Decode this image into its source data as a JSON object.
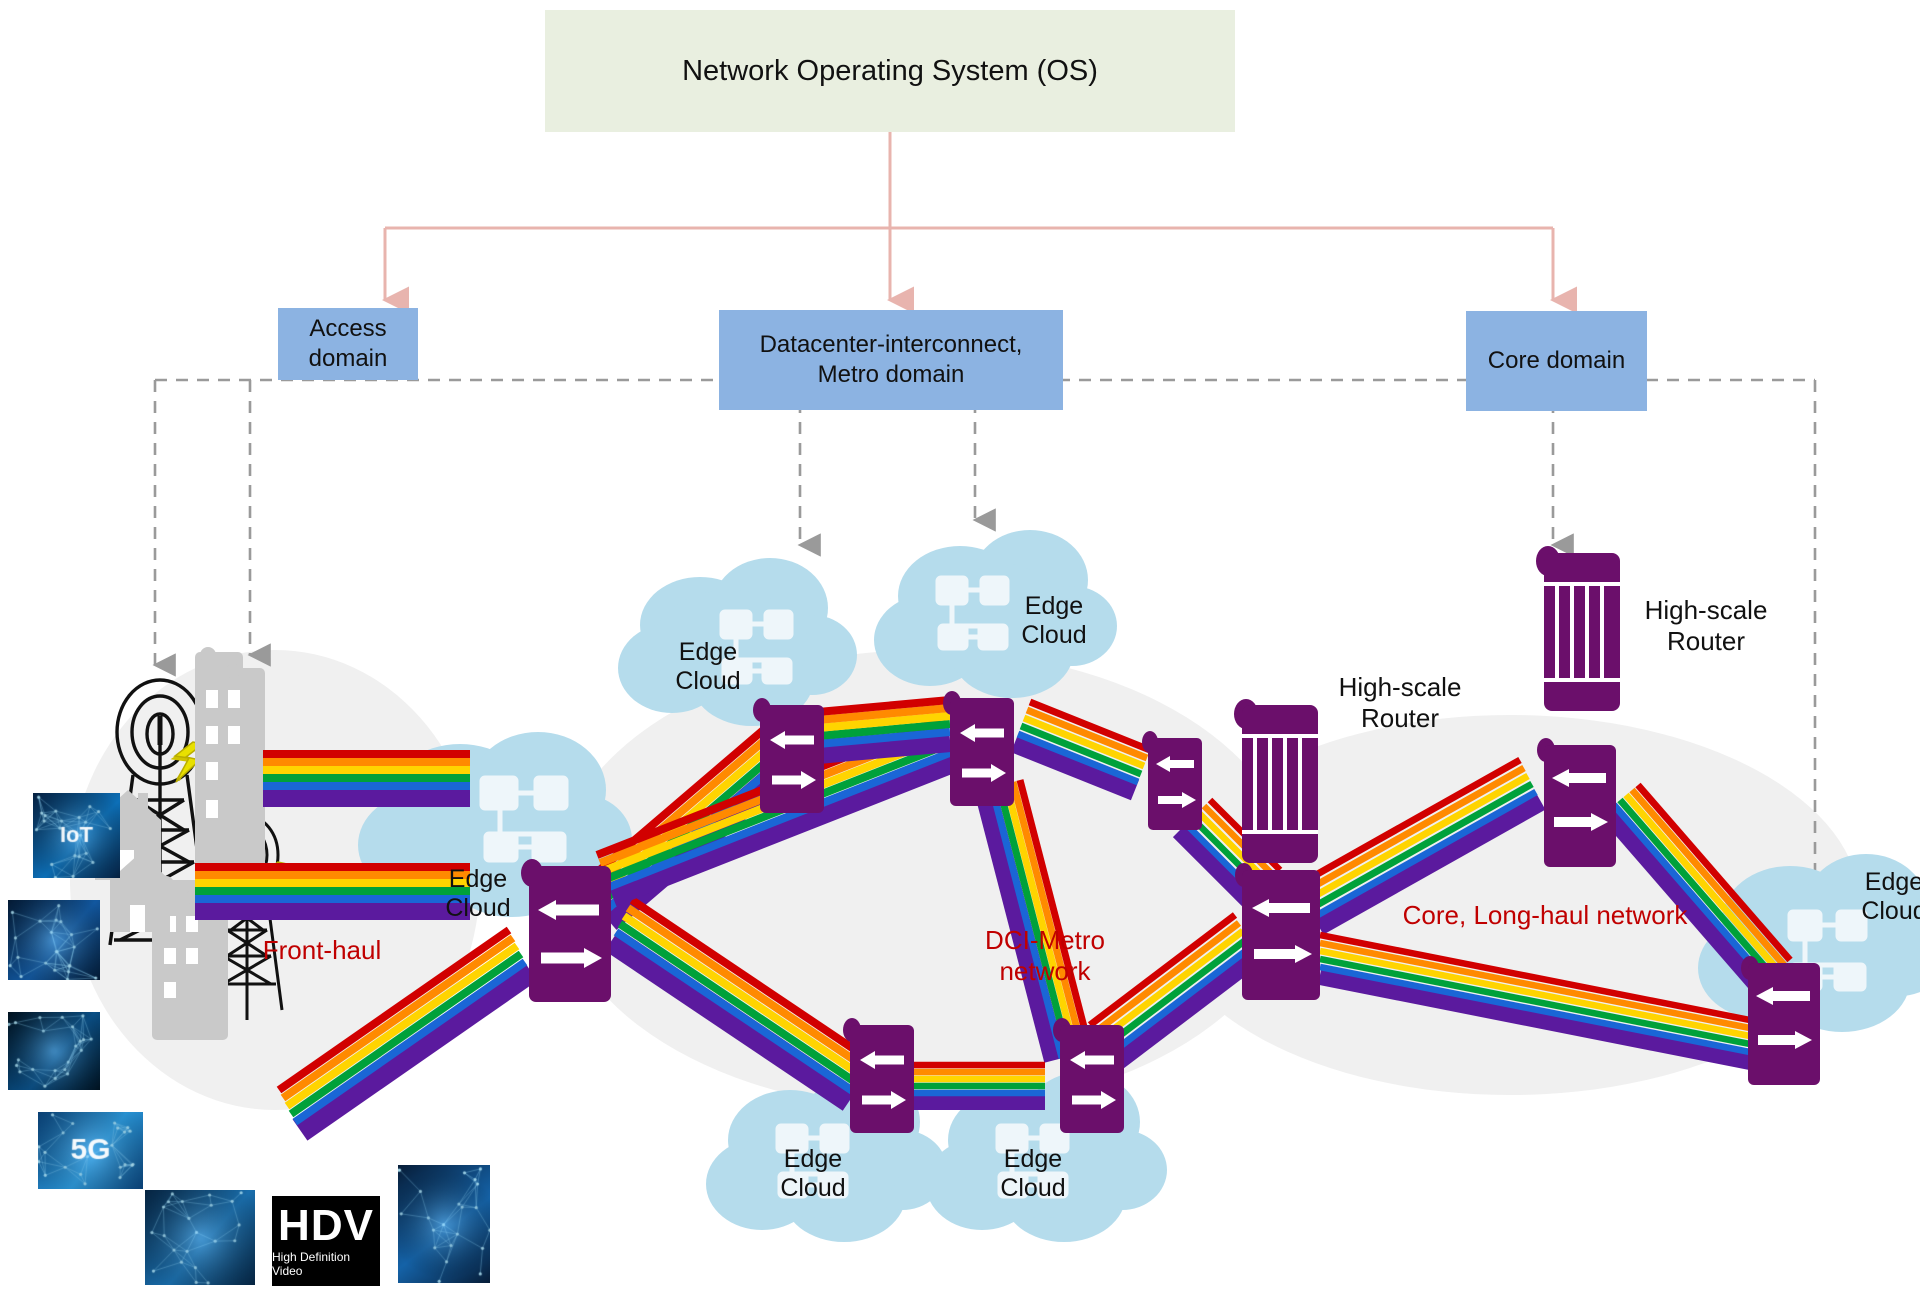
{
  "diagram": {
    "title": "Network Operating System (OS)",
    "domains": [
      {
        "id": "access",
        "label": "Access domain"
      },
      {
        "id": "dci",
        "label": "Datacenter-interconnect, Metro domain"
      },
      {
        "id": "core",
        "label": "Core domain"
      }
    ],
    "network_labels": [
      {
        "id": "fronthaul",
        "text": "Front-haul",
        "color": "#c00000"
      },
      {
        "id": "dci-metro",
        "text": "DCI-Metro network",
        "color": "#c00000"
      },
      {
        "id": "core-longhaul",
        "text": "Core, Long-haul network",
        "color": "#c00000"
      }
    ],
    "device_labels": [
      {
        "id": "hsr-core",
        "text": "High-scale Router",
        "color": "#111111"
      },
      {
        "id": "hsr-metro",
        "text": "High-scale Router",
        "color": "#111111"
      }
    ],
    "edge_clouds": [
      {
        "id": "ec-access",
        "text": "Edge Cloud"
      },
      {
        "id": "ec-metro-left",
        "text": "Edge Cloud"
      },
      {
        "id": "ec-metro-top",
        "text": "Edge Cloud"
      },
      {
        "id": "ec-metro-bl",
        "text": "Edge Cloud"
      },
      {
        "id": "ec-metro-br",
        "text": "Edge Cloud"
      },
      {
        "id": "ec-core-right",
        "text": "Edge Cloud"
      }
    ],
    "thumbnails": [
      {
        "id": "iot",
        "caption": "IoT"
      },
      {
        "id": "vr",
        "caption": ""
      },
      {
        "id": "bigdata",
        "caption": ""
      },
      {
        "id": "fiveg",
        "caption": "5G"
      },
      {
        "id": "industry",
        "caption": ""
      },
      {
        "id": "hdv",
        "caption": "HDV",
        "subcaption": "High Definition Video"
      },
      {
        "id": "touch",
        "caption": ""
      }
    ],
    "colors": {
      "nos_fill": "#e9efe0",
      "domain_fill": "#8cb3e2",
      "node_purple": "#6b0f6b",
      "cloud_blue": "#b5dcec",
      "region_gray": "#f0f0f0",
      "arrow_pink": "#e8b4ae",
      "dashed_gray": "#9a9a9a",
      "accent_red": "#c00000"
    },
    "fiber_colors": [
      "#d10000",
      "#ff8a00",
      "#ffd400",
      "#00a13a",
      "#1a66d6",
      "#5b1a9e"
    ],
    "icon_names": [
      "cell-tower-icon",
      "office-building-icon",
      "house-icon",
      "switch-node-icon",
      "high-scale-router-icon",
      "edge-cloud-icon",
      "lightning-icon",
      "arrow-down-icon",
      "fiber-link-icon"
    ]
  }
}
